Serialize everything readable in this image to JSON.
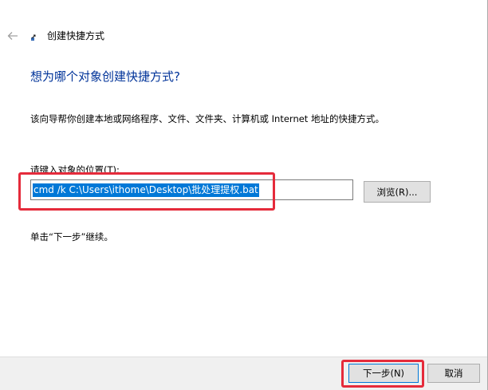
{
  "header": {
    "title": "创建快捷方式",
    "back_icon": "back-arrow-icon",
    "wizard_icon": "shortcut-wizard-icon"
  },
  "main": {
    "heading": "想为哪个对象创建快捷方式?",
    "description": "该向导帮你创建本地或网络程序、文件、文件夹、计算机或 Internet 地址的快捷方式。",
    "location_label": "请键入对象的位置(T):",
    "location_value": "cmd /k C:\\Users\\ithome\\Desktop\\批处理提权.bat",
    "browse_label": "浏览(R)...",
    "hint": "单击“下一步”继续。"
  },
  "footer": {
    "next_label": "下一步(N)",
    "cancel_label": "取消"
  },
  "colors": {
    "heading": "#003399",
    "selection": "#0078d7",
    "annotation": "#e52b3b",
    "footer_bg": "#f0f0f0"
  }
}
